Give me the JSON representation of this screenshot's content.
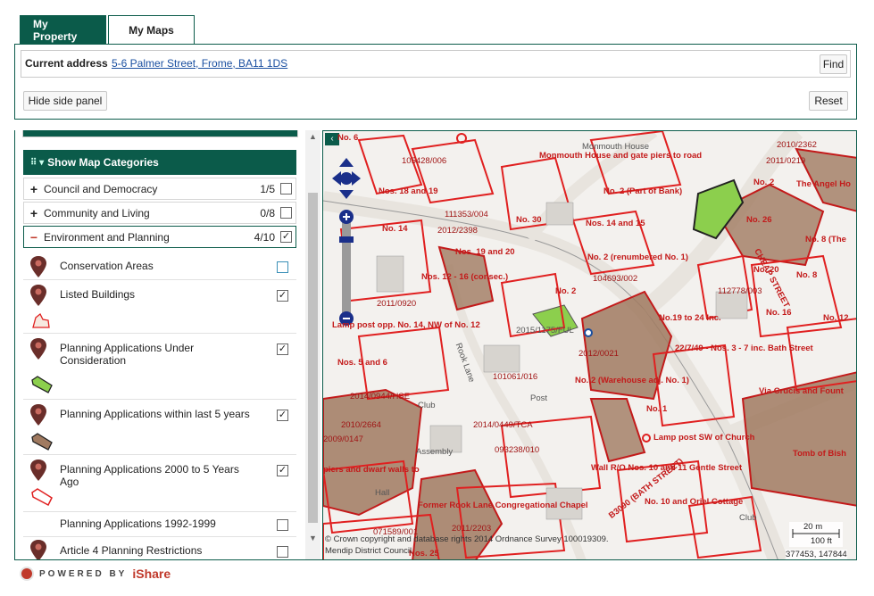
{
  "tabs": {
    "my_property": "My Property",
    "my_maps": "My Maps"
  },
  "address": {
    "label": "Current address",
    "value": "5-6 Palmer Street, Frome, BA11 1DS",
    "find": "Find"
  },
  "controls": {
    "hide_panel": "Hide side panel",
    "reset": "Reset"
  },
  "categories": {
    "header": "Show Map Categories",
    "items": [
      {
        "sign": "+",
        "name": "Council and Democracy",
        "count": "1/5"
      },
      {
        "sign": "+",
        "name": "Community and Living",
        "count": "0/8"
      },
      {
        "sign": "−",
        "name": "Environment and Planning",
        "count": "4/10"
      }
    ]
  },
  "layers": [
    {
      "name": "Conservation Areas",
      "checked": false
    },
    {
      "name": "Listed Buildings",
      "checked": true
    },
    {
      "name": "Planning Applications Under Consideration",
      "checked": true
    },
    {
      "name": "Planning Applications within last 5 years",
      "checked": true
    },
    {
      "name": "Planning Applications 2000 to 5 Years Ago",
      "checked": true
    },
    {
      "name": "Planning Applications 1992-1999",
      "checked": false
    },
    {
      "name": "Article 4 Planning Restrictions",
      "checked": false
    }
  ],
  "colors": {
    "brand": "#0b5b4a",
    "planning_red": "#e02020",
    "under_consideration": "#8ccf4d",
    "last_5_years": "#a07a60"
  },
  "map": {
    "labels": {
      "no6": "No. 6",
      "monmouth_house": "Monmouth House",
      "monmouth_piers": "Monmouth House and gate piers to road",
      "ref_2010_2362": "2010/2362",
      "ref_2011_0219": "2011/0219",
      "ref_10542_006": "105428/006",
      "nos_18_19": "Nos. 18 and 19",
      "no2_part_bank": "No. 2 (Part of Bank)",
      "no2": "No. 2",
      "angel_house": "The Angel Ho",
      "ref_111353_004": "111353/004",
      "no30": "No. 30",
      "no26": "No. 26",
      "nos_14_15": "Nos. 14 and 15",
      "no14": "No. 14",
      "ref_2012_2398": "2012/2398",
      "no8_the": "No. 8 (The",
      "nos_19_20": "Nos. 19 and 20",
      "no2_renumbered": "No. 2 (renumbered No. 1)",
      "no20": "No. 20",
      "nos_12_16": "Nos. 12 - 16 (consec.)",
      "ref_104693_002": "104693/002",
      "no8": "No. 8",
      "no2b": "No. 2",
      "ref_112778_003": "112778/003",
      "ref_2011_0920": "2011/0920",
      "no16": "No. 16",
      "no12": "No. 12",
      "no19_24": "No.19 to 24 Inc.",
      "lamp_post": "Lamp post opp. No. 14, NW of No. 12",
      "ref_2015_1175": "2015/1175/FUL",
      "ref_22_7_49": "22/7/49 - Nos. 3 - 7 inc. Bath Street",
      "ref_2012_0021": "2012/0021",
      "nos_5_6": "Nos. 5 and 6",
      "ref_101061_016": "101061/016",
      "no2_warehouse": "No. 2 (Warehouse adj. No. 1)",
      "via_crucis": "Via Crucis and Fount",
      "ref_2014_0944": "2014/0944/HSE",
      "post": "Post",
      "club": "Club",
      "no1": "No. 1",
      "ref_2010_2664": "2010/2664",
      "ref_2014_0449": "2014/0449/TCA",
      "ref_2009_0147": "2009/0147",
      "lamp_post_sw": "Lamp post SW of Church",
      "tomb": "Tomb of Bish",
      "assembly": "Assembly",
      "ref_093238_010": "093238/010",
      "piers_walls": "piers and dwarf walls to",
      "wall_ro": "Wall R/O Nos. 10 and 11 Gentle Street",
      "hall": "Hall",
      "bath_street": "B3090 (BATH STREET)",
      "no10_oriel": "No. 10 and Oriel Cottage",
      "former_rook": "Former Rook Lane Congregational Chapel",
      "ref_2011_2203": "2011/2203",
      "ref_071589_001": "071589/001",
      "nos_25": "Nos. 25",
      "cheap_street": "CHEAP STREET",
      "rook_lane": "Rook Lane",
      "club2": "Club"
    },
    "copyright": "© Crown copyright and database rights 2014 Ordnance Survey 100019309.",
    "council": "Mendip District Council",
    "scale_m": "20 m",
    "scale_ft": "100 ft",
    "coords": "377453, 147844"
  },
  "footer": {
    "powered": "POWERED BY",
    "brand": "iShare"
  }
}
